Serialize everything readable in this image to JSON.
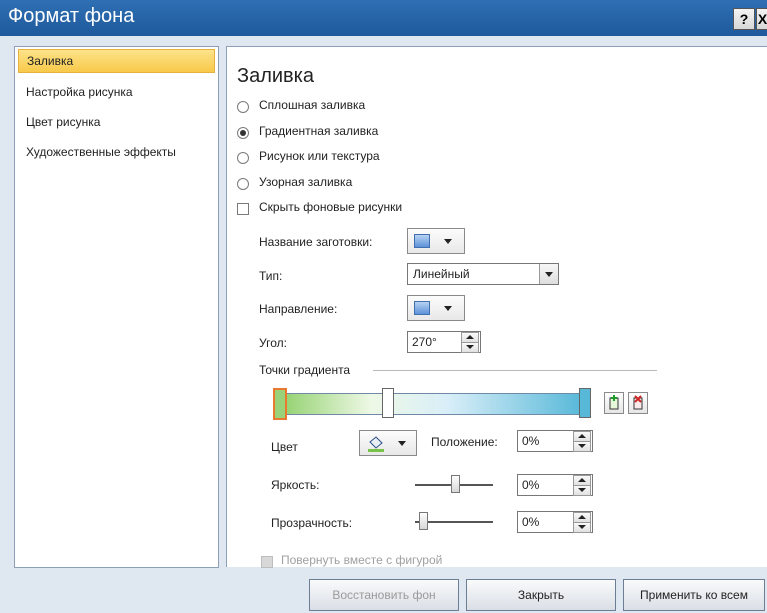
{
  "window": {
    "title": "Формат фона",
    "help_label": "?",
    "close_label": "X"
  },
  "sidebar": {
    "items": [
      {
        "label": "Заливка"
      },
      {
        "label": "Настройка рисунка"
      },
      {
        "label": "Цвет рисунка"
      },
      {
        "label": "Художественные эффекты"
      }
    ],
    "selected": "Заливка"
  },
  "fill": {
    "heading": "Заливка",
    "options": [
      {
        "label": "Сплошная заливка",
        "checked": false
      },
      {
        "label": "Градиентная заливка",
        "checked": true
      },
      {
        "label": "Рисунок или текстура",
        "checked": false
      },
      {
        "label": "Узорная заливка",
        "checked": false
      }
    ],
    "hide_bg_label": "Скрыть фоновые рисунки",
    "preset_label": "Название заготовки:",
    "type_label": "Тип:",
    "type_value": "Линейный",
    "direction_label": "Направление:",
    "angle_label": "Угол:",
    "angle_value": "270°",
    "stops_label": "Точки градиента",
    "color_label": "Цвет",
    "position_label": "Положение:",
    "position_value": "0%",
    "brightness_label": "Яркость:",
    "brightness_value": "0%",
    "transparency_label": "Прозрачность:",
    "transparency_value": "0%",
    "rotate_label": "Повернуть вместе с фигурой",
    "gradient_colors": [
      "#8fd06a",
      "#eef8e6",
      "#d8eef8",
      "#52b6d7"
    ]
  },
  "footer": {
    "restore_label": "Восстановить фон",
    "close_label": "Закрыть",
    "apply_all_label": "Применить ко всем"
  }
}
